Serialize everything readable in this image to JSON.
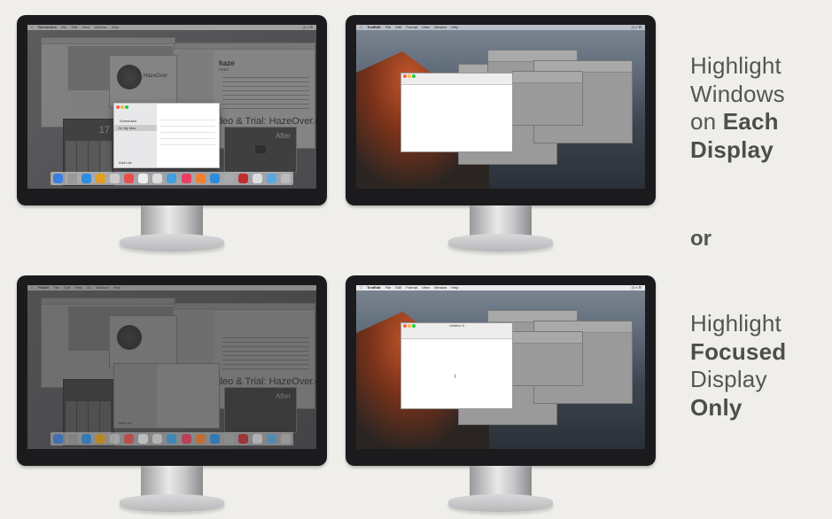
{
  "caption_top": [
    "Highlight",
    "Windows",
    "on",
    "Each",
    "Display"
  ],
  "caption_or": "or",
  "caption_bottom": [
    "Highlight",
    "Focused",
    "Display",
    "Only"
  ],
  "left_screen": {
    "menu": [
      "Reminders",
      "File",
      "Edit",
      "View",
      "Window",
      "Help"
    ],
    "menu_bottom": [
      "Finder",
      "File",
      "Edit",
      "View",
      "Go",
      "Window",
      "Help"
    ],
    "dictionary_word": "haze",
    "dictionary_pos": "noun",
    "promo": "mo Video & Trial: HazeOver.com",
    "badge": "HazeOver",
    "after": "After",
    "reminders": [
      "Scheduled",
      "On My Mac"
    ],
    "add_list": "Add List",
    "calc_display": "17"
  },
  "right_screen": {
    "menu": [
      "TextEdit",
      "File",
      "Edit",
      "Format",
      "View",
      "Window",
      "Help"
    ],
    "doc_title": "Untitled 3",
    "doc_cursor": "I"
  },
  "colors": {
    "background": "#efeeea",
    "bezel": "#1b1b1d",
    "caption": "#555555"
  }
}
